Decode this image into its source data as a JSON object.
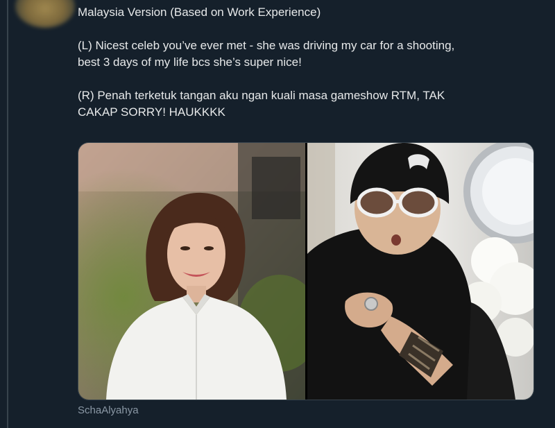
{
  "tweet": {
    "lines": [
      "Malaysia Version (Based on Work Experience)",
      "(L) Nicest celeb you’ve ever met - she was driving my car for a shooting,",
      "best 3 days of my life bcs she’s super nice!",
      "(R) Penah terketuk tangan aku ngan kuali masa gameshow RTM, TAK",
      "CAKAP SORRY! HAUKKKK"
    ]
  },
  "media": {
    "left_photo": "portrait-woman-white-shirt",
    "right_photo": "portrait-man-black-beanie-sunglasses"
  },
  "caption": {
    "handle": "SchaAlyahya"
  },
  "colors": {
    "background": "#15202b",
    "text": "#e7e9ea",
    "muted": "#8b98a5",
    "border": "#38444d"
  }
}
